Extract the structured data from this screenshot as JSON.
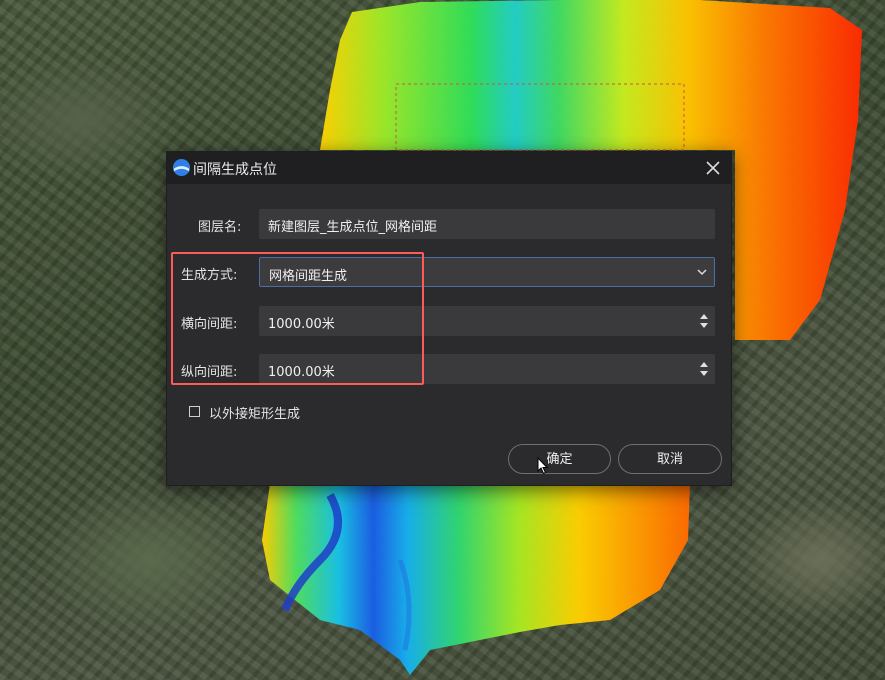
{
  "dialog": {
    "title": "间隔生成点位",
    "layer_name_label": "图层名:",
    "layer_name_value": "新建图层_生成点位_网格间距",
    "method_label": "生成方式:",
    "method_value": "网格间距生成",
    "h_spacing_label": "横向间距:",
    "h_spacing_value": "1000.00米",
    "v_spacing_label": "纵向间距:",
    "v_spacing_value": "1000.00米",
    "bbox_checkbox_label": "以外接矩形生成",
    "bbox_checkbox_checked": false,
    "ok_label": "确定",
    "cancel_label": "取消"
  },
  "icons": [
    "app-logo-icon",
    "close-icon",
    "chevron-down-icon",
    "spinner-arrows-icon",
    "mouse-cursor-icon"
  ],
  "colors": {
    "dialog_bg": "#2b2b2d",
    "titlebar_bg": "#1f1f21",
    "field_bg": "#3a3a3c",
    "select_border": "#4a6fa3",
    "highlight_border": "#ff5a5a"
  }
}
